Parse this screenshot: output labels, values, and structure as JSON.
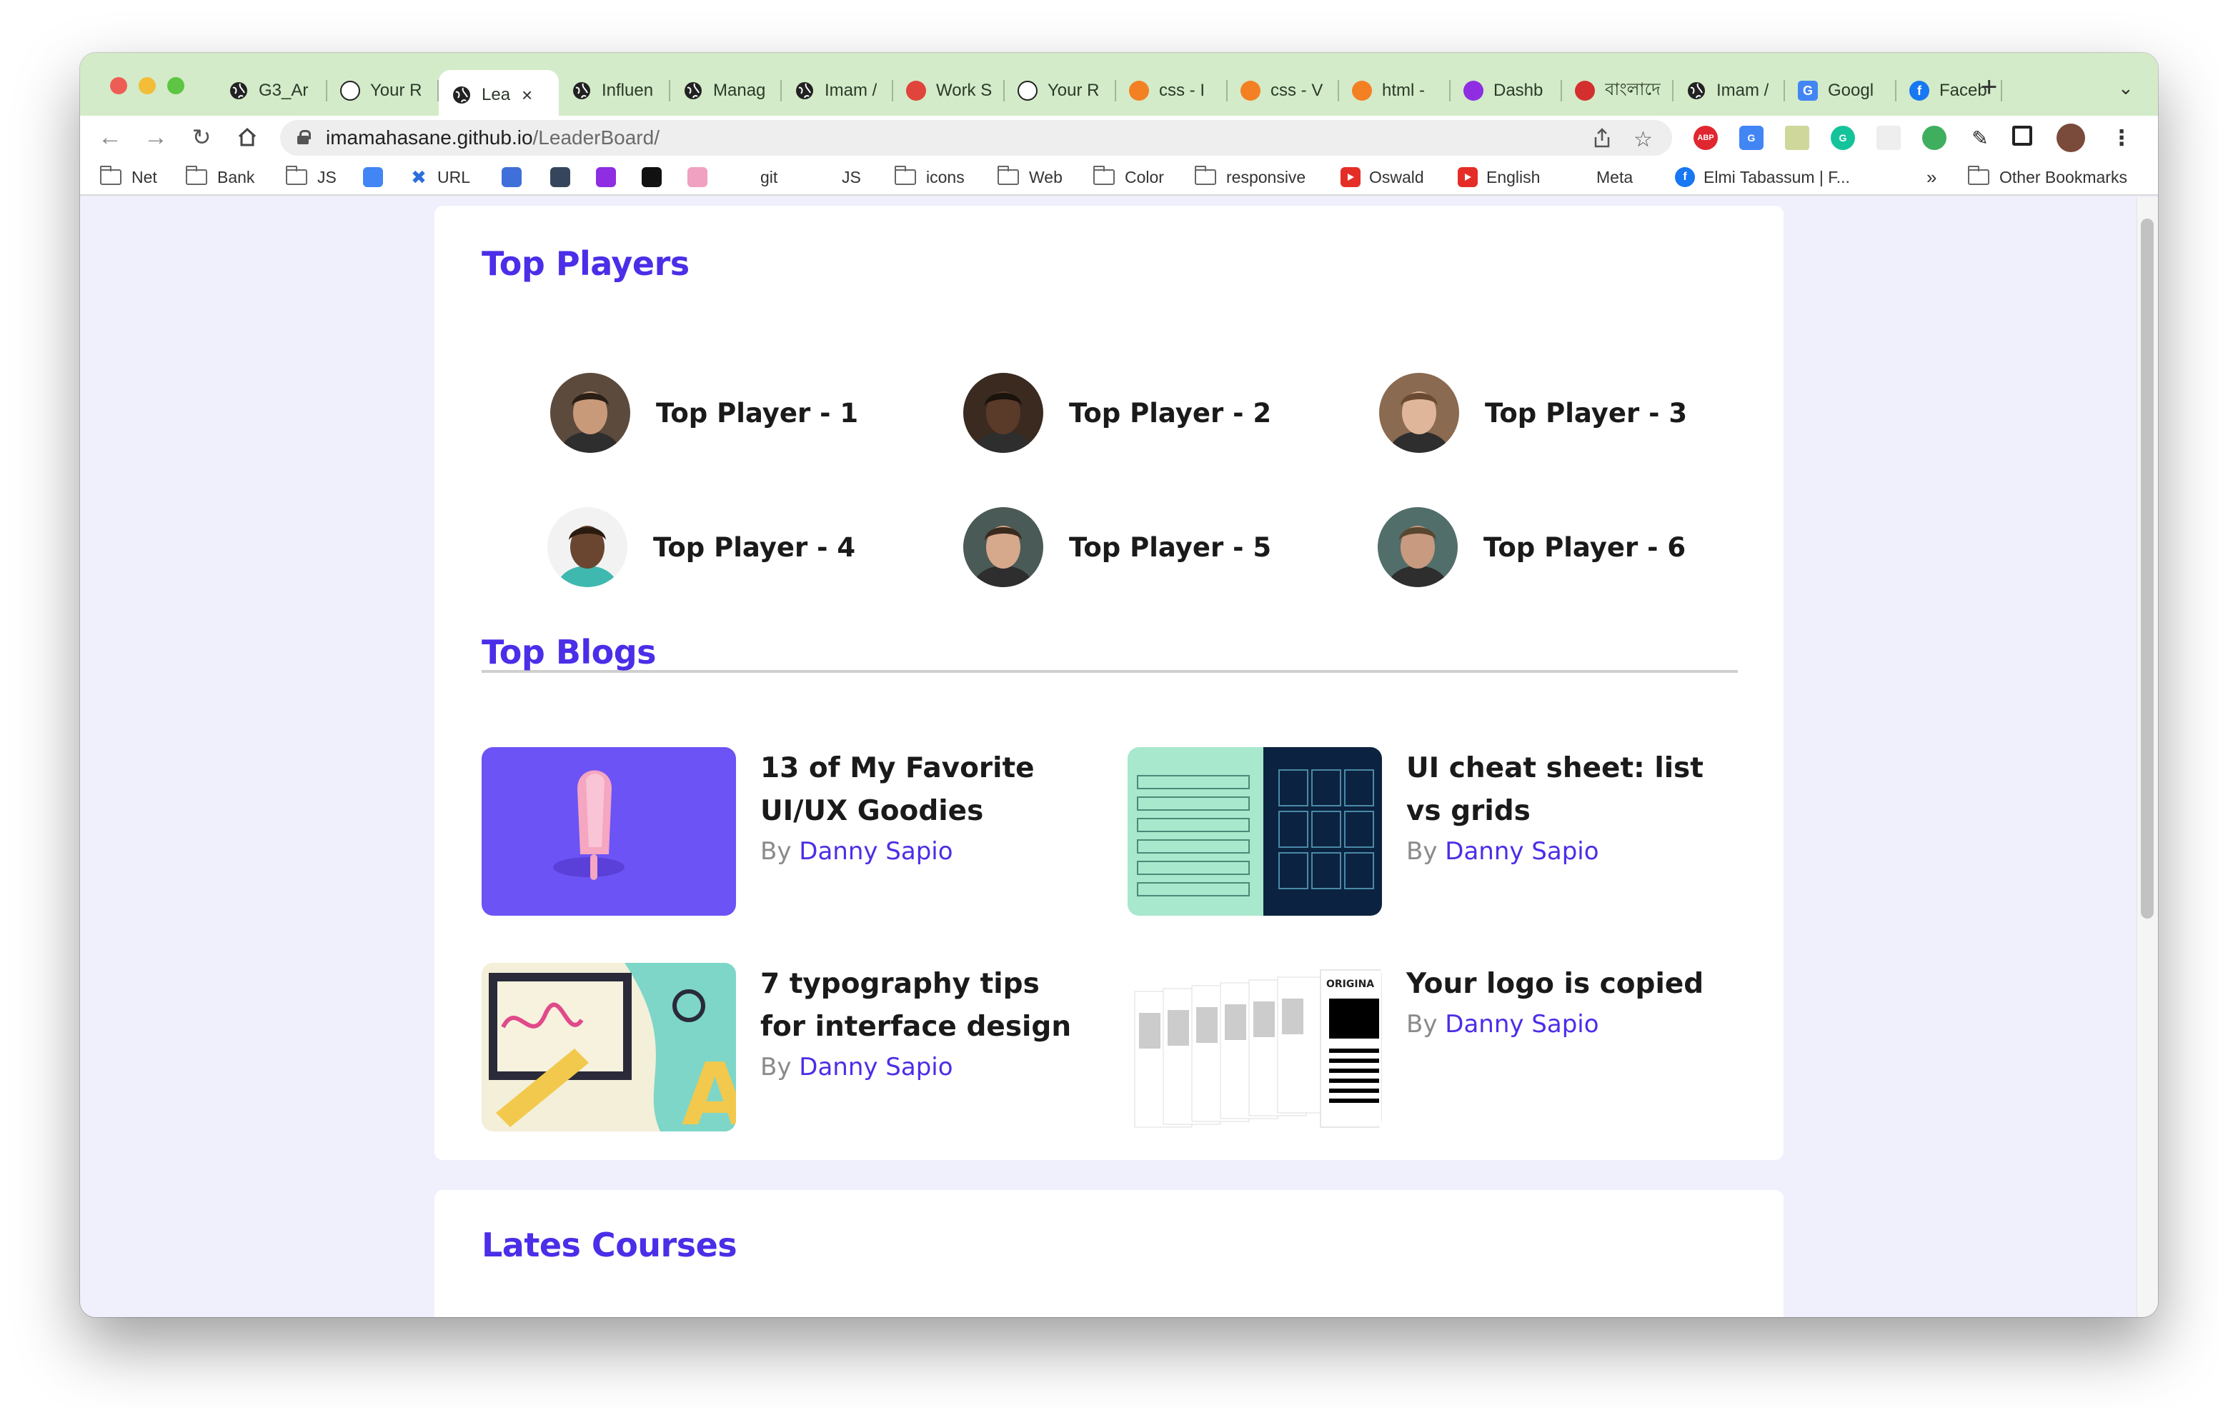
{
  "browser": {
    "tabs": [
      {
        "label": "G3_Ar",
        "icon": "globe-icon",
        "color": "#222222"
      },
      {
        "label": "Your R",
        "icon": "github-icon",
        "color": "#222222"
      },
      {
        "label": "Lea",
        "icon": "globe-icon",
        "color": "#222222",
        "active": true
      },
      {
        "label": "Influen",
        "icon": "globe-icon",
        "color": "#222222"
      },
      {
        "label": "Manag",
        "icon": "globe-icon",
        "color": "#222222"
      },
      {
        "label": "Imam /",
        "icon": "globe-icon",
        "color": "#222222"
      },
      {
        "label": "Work S",
        "icon": "workspace-icon",
        "color": "#e0443a"
      },
      {
        "label": "Your R",
        "icon": "github-icon",
        "color": "#222222"
      },
      {
        "label": "css - I",
        "icon": "stackoverflow-icon",
        "color": "#f48024"
      },
      {
        "label": "css - V",
        "icon": "stackoverflow-icon",
        "color": "#f48024"
      },
      {
        "label": "html -",
        "icon": "stackoverflow-icon",
        "color": "#f48024"
      },
      {
        "label": "Dashb",
        "icon": "dashboard-icon",
        "color": "#8e2de2"
      },
      {
        "label": "বাংলাদে",
        "icon": "seal-icon",
        "color": "#d32f2f"
      },
      {
        "label": "Imam /",
        "icon": "globe-icon",
        "color": "#222222"
      },
      {
        "label": "Googl",
        "icon": "translate-icon",
        "color": "#4285f4"
      },
      {
        "label": "Faceb",
        "icon": "facebook-icon",
        "color": "#1877f2"
      }
    ],
    "new_tab": "+",
    "url_host": "imamahasane.github.io",
    "url_path": "/LeaderBoard/",
    "bookmarks": [
      {
        "label": "Net",
        "type": "folder"
      },
      {
        "label": "Bank",
        "type": "folder"
      },
      {
        "label": "JS",
        "type": "folder"
      },
      {
        "label": "",
        "type": "icon",
        "icon": "translate-icon",
        "color": "#4285f4"
      },
      {
        "label": "URL",
        "type": "icon",
        "icon": "url-icon",
        "color": "#2a6fdb"
      },
      {
        "label": "",
        "type": "icon",
        "icon": "pin-icon",
        "color": "#3f6fd8"
      },
      {
        "label": "",
        "type": "icon",
        "icon": "tumblr-icon",
        "color": "#35465c"
      },
      {
        "label": "",
        "type": "icon",
        "icon": "dashboard-icon",
        "color": "#8e2de2"
      },
      {
        "label": "",
        "type": "icon",
        "icon": "notion-icon",
        "color": "#111111"
      },
      {
        "label": "",
        "type": "icon",
        "icon": "dribbble-icon",
        "color": "#f0a0c0"
      },
      {
        "label": "git",
        "type": "text"
      },
      {
        "label": "JS",
        "type": "text"
      },
      {
        "label": "icons",
        "type": "folder"
      },
      {
        "label": "Web",
        "type": "folder"
      },
      {
        "label": "Color",
        "type": "folder"
      },
      {
        "label": "responsive",
        "type": "folder"
      },
      {
        "label": "Oswald",
        "type": "icon",
        "icon": "youtube-icon",
        "color": "#e52d27"
      },
      {
        "label": "English",
        "type": "icon",
        "icon": "youtube-icon",
        "color": "#e52d27"
      },
      {
        "label": "Meta",
        "type": "text"
      },
      {
        "label": "Elmi Tabassum | F...",
        "type": "icon",
        "icon": "facebook-icon",
        "color": "#1877f2"
      }
    ],
    "more_bookmarks": "»",
    "other_bookmarks": "Other Bookmarks"
  },
  "page": {
    "top_players_title": "Top Players",
    "players": [
      {
        "name": "Top Player - 1"
      },
      {
        "name": "Top Player - 2"
      },
      {
        "name": "Top Player - 3"
      },
      {
        "name": "Top Player - 4"
      },
      {
        "name": "Top Player - 5"
      },
      {
        "name": "Top Player - 6"
      }
    ],
    "top_blogs_title": "Top Blogs",
    "blogs": [
      {
        "title": "13 of My Favorite UI/UX Goodies",
        "by": "By",
        "author": "Danny Sapio"
      },
      {
        "title": "UI cheat sheet: list vs grids",
        "by": "By",
        "author": "Danny Sapio"
      },
      {
        "title": "7 typography tips for interface design",
        "by": "By",
        "author": "Danny Sapio"
      },
      {
        "title": "Your logo is copied",
        "by": "By",
        "author": "Danny Sapio"
      }
    ],
    "courses_title": "Lates Courses",
    "thumb_label": "ORIGINA"
  },
  "colors": {
    "accent": "#4a2ee8",
    "page_bg": "#f0effc",
    "tabstrip": "#d3ebc8"
  }
}
